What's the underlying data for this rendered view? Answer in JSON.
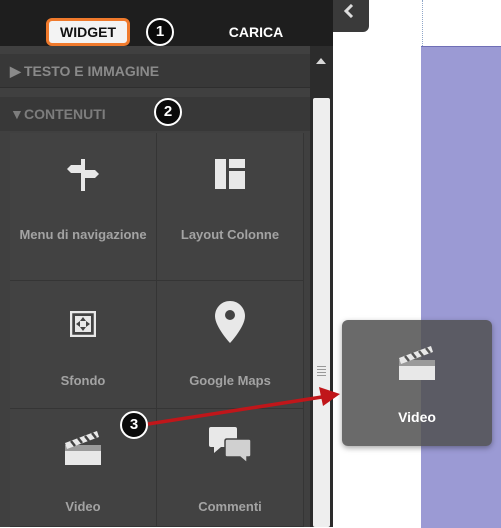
{
  "tabs": {
    "widget": "WIDGET",
    "carica": "CARICA"
  },
  "badges": [
    "1",
    "2",
    "3"
  ],
  "sections": {
    "testo": "TESTO E IMMAGINE",
    "contenuti": "CONTENUTI"
  },
  "tiles": [
    {
      "label": "Menu di navigazione",
      "icon": "signpost-icon"
    },
    {
      "label": "Layout Colonne",
      "icon": "columns-layout-icon"
    },
    {
      "label": "Sfondo",
      "icon": "background-icon"
    },
    {
      "label": "Google Maps",
      "icon": "map-pin-icon"
    },
    {
      "label": "Video",
      "icon": "clapperboard-icon"
    },
    {
      "label": "Commenti",
      "icon": "chat-bubbles-icon"
    }
  ],
  "drag_widget": {
    "label": "Video",
    "icon": "clapperboard-icon"
  },
  "colors": {
    "panel": "#404040",
    "tab_highlight": "#f07a2c",
    "drop_zone": "#9b9ad4",
    "arrow": "#c0161a"
  }
}
